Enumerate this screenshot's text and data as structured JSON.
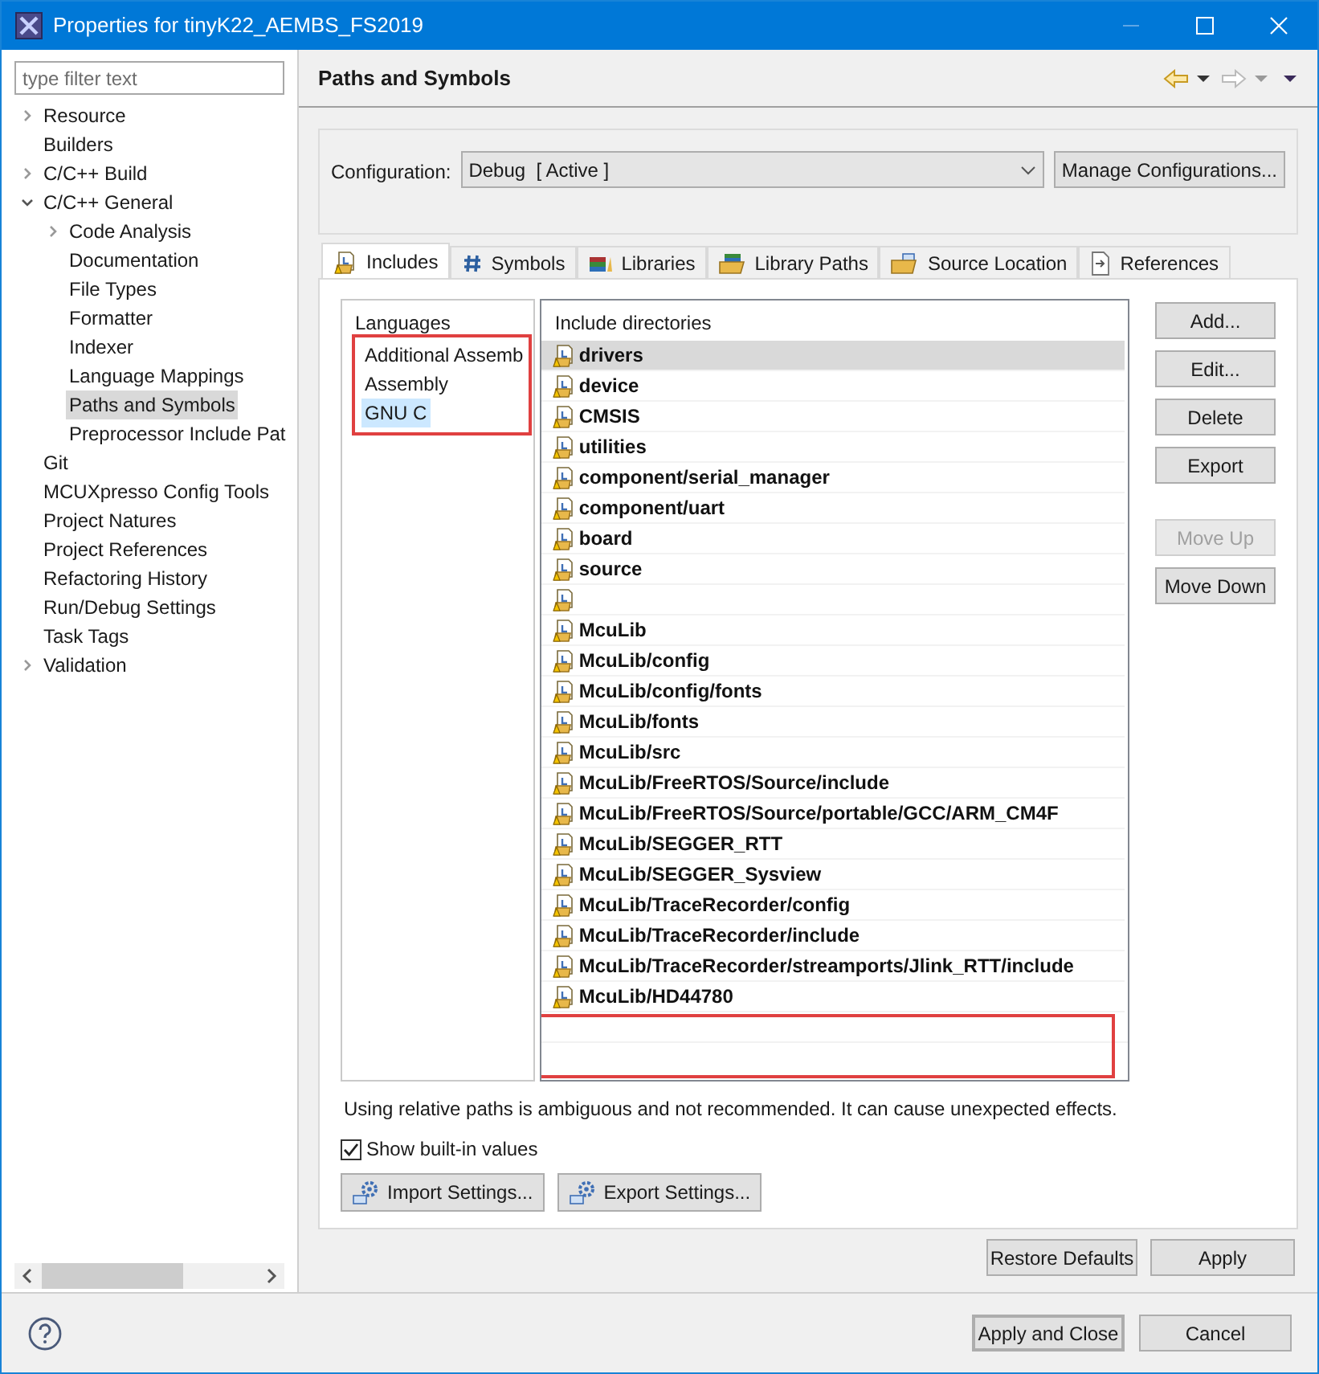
{
  "window": {
    "title": "Properties for tinyK22_AEMBS_FS2019"
  },
  "filter": {
    "placeholder": "type filter text"
  },
  "tree": [
    {
      "label": "Resource",
      "expanded": false,
      "selected": false
    },
    {
      "label": "Builders",
      "selected": false
    },
    {
      "label": "C/C++ Build",
      "expanded": false,
      "selected": false
    },
    {
      "label": "C/C++ General",
      "expanded": true,
      "selected": false,
      "children": [
        {
          "label": "Code Analysis",
          "expanded": false,
          "selected": false
        },
        {
          "label": "Documentation",
          "selected": false
        },
        {
          "label": "File Types",
          "selected": false
        },
        {
          "label": "Formatter",
          "selected": false
        },
        {
          "label": "Indexer",
          "selected": false
        },
        {
          "label": "Language Mappings",
          "selected": false
        },
        {
          "label": "Paths and Symbols",
          "selected": true
        },
        {
          "label": "Preprocessor Include Pat",
          "selected": false
        }
      ]
    },
    {
      "label": "Git",
      "selected": false
    },
    {
      "label": "MCUXpresso Config Tools",
      "selected": false
    },
    {
      "label": "Project Natures",
      "selected": false
    },
    {
      "label": "Project References",
      "selected": false
    },
    {
      "label": "Refactoring History",
      "selected": false
    },
    {
      "label": "Run/Debug Settings",
      "selected": false
    },
    {
      "label": "Task Tags",
      "selected": false
    },
    {
      "label": "Validation",
      "expanded": false,
      "selected": false
    }
  ],
  "page": {
    "title": "Paths and Symbols"
  },
  "configuration": {
    "label": "Configuration:",
    "value": "Debug  [ Active ]",
    "button": "Manage Configurations..."
  },
  "tabs": [
    {
      "label": "Includes",
      "selected": true
    },
    {
      "label": "Symbols",
      "selected": false
    },
    {
      "label": "Libraries",
      "selected": false
    },
    {
      "label": "Library Paths",
      "selected": false
    },
    {
      "label": "Source Location",
      "selected": false
    },
    {
      "label": "References",
      "selected": false
    }
  ],
  "languages": {
    "heading": "Languages",
    "items": [
      {
        "label": "Additional Assemb",
        "selected": false
      },
      {
        "label": "Assembly",
        "selected": false
      },
      {
        "label": "GNU C",
        "selected": true
      }
    ]
  },
  "includes": {
    "heading": "Include directories",
    "items": [
      {
        "label": "drivers",
        "selected": true
      },
      {
        "label": "device",
        "selected": false
      },
      {
        "label": "CMSIS",
        "selected": false
      },
      {
        "label": "utilities",
        "selected": false
      },
      {
        "label": "component/serial_manager",
        "selected": false
      },
      {
        "label": "component/uart",
        "selected": false
      },
      {
        "label": "board",
        "selected": false
      },
      {
        "label": "source",
        "selected": false
      },
      {
        "selected": false
      },
      {
        "label": "McuLib",
        "selected": false
      },
      {
        "label": "McuLib/config",
        "selected": false
      },
      {
        "label": "McuLib/config/fonts",
        "selected": false
      },
      {
        "label": "McuLib/fonts",
        "selected": false
      },
      {
        "label": "McuLib/src",
        "selected": false
      },
      {
        "label": "McuLib/FreeRTOS/Source/include",
        "selected": false
      },
      {
        "label": "McuLib/FreeRTOS/Source/portable/GCC/ARM_CM4F",
        "selected": false
      },
      {
        "label": "McuLib/SEGGER_RTT",
        "selected": false
      },
      {
        "label": "McuLib/SEGGER_Sysview",
        "selected": false
      },
      {
        "label": "McuLib/TraceRecorder/config",
        "selected": false
      },
      {
        "label": "McuLib/TraceRecorder/include",
        "selected": false
      },
      {
        "label": "McuLib/TraceRecorder/streamports/Jlink_RTT/include",
        "selected": false
      },
      {
        "label": "McuLib/HD44780",
        "selected": false
      }
    ]
  },
  "side_buttons": [
    {
      "label": "Add...",
      "disabled": false
    },
    {
      "label": "Edit...",
      "disabled": false
    },
    {
      "label": "Delete",
      "disabled": false
    },
    {
      "label": "Export",
      "disabled": false
    },
    {
      "label": "Move Up",
      "disabled": true
    },
    {
      "label": "Move Down",
      "disabled": false
    }
  ],
  "note": "Using relative paths is ambiguous and not recommended. It can cause unexpected effects.",
  "show_builtin": {
    "label": "Show built-in values",
    "checked": true
  },
  "settings_buttons": [
    "Import Settings...",
    "Export Settings..."
  ],
  "page_buttons": [
    "Restore Defaults",
    "Apply"
  ],
  "dialog_buttons": [
    {
      "label": "Apply and Close",
      "default": true
    },
    {
      "label": "Cancel",
      "default": false
    }
  ]
}
